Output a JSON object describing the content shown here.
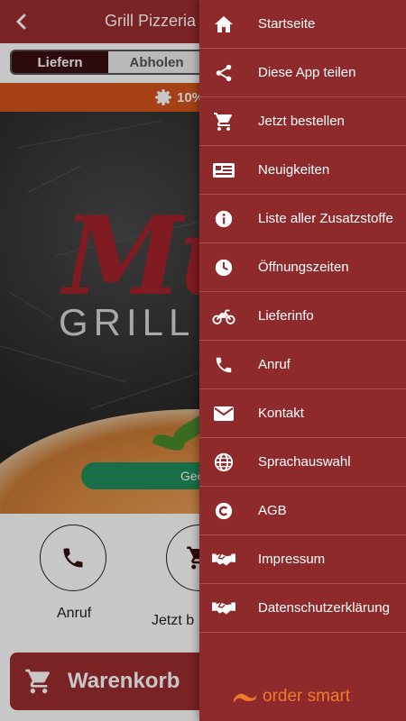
{
  "header": {
    "title": "Grill Pizzeria M"
  },
  "segment": {
    "deliver_label": "Liefern",
    "pickup_label": "Abholen",
    "selected": "Liefern"
  },
  "promo": {
    "text": "10%"
  },
  "hero": {
    "logo_text": "Mu",
    "subtitle": "GRILL – P",
    "status_button": "Geö"
  },
  "actions": {
    "call_label": "Anruf",
    "order_label": "Jetzt b"
  },
  "cart": {
    "label": "Warenkorb"
  },
  "drawer": {
    "items": [
      {
        "label": "Startseite",
        "icon": "home-icon"
      },
      {
        "label": "Diese App teilen",
        "icon": "share-icon"
      },
      {
        "label": "Jetzt bestellen",
        "icon": "cart-icon"
      },
      {
        "label": "Neuigkeiten",
        "icon": "news-icon"
      },
      {
        "label": "Liste aller Zusatzstoffe",
        "icon": "info-icon"
      },
      {
        "label": "Öffnungszeiten",
        "icon": "clock-icon"
      },
      {
        "label": "Lieferinfo",
        "icon": "motorbike-icon"
      },
      {
        "label": "Anruf",
        "icon": "phone-icon"
      },
      {
        "label": "Kontakt",
        "icon": "mail-icon"
      },
      {
        "label": "Sprachauswahl",
        "icon": "globe-icon"
      },
      {
        "label": "AGB",
        "icon": "copyright-icon"
      },
      {
        "label": "Impressum",
        "icon": "handshake-icon"
      },
      {
        "label": "Datenschutzerklärung",
        "icon": "handshake-icon"
      }
    ],
    "brand": "order smart"
  },
  "colors": {
    "brand_red": "#9b2d2f",
    "drawer_red": "#8e2a2c",
    "promo_orange": "#d4541c",
    "brand_orange": "#f07a2c",
    "status_green": "#1f8f5c"
  }
}
